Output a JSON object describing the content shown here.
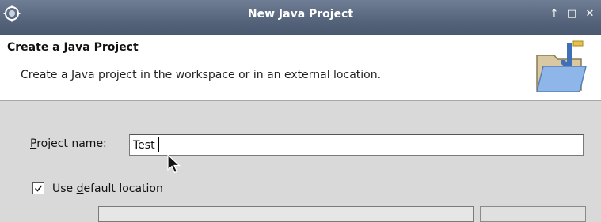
{
  "window": {
    "title": "New Java Project",
    "buttons": {
      "maximize": "↑",
      "restore": "□",
      "close": "✕"
    }
  },
  "header": {
    "title": "Create a Java Project",
    "description": "Create a Java project in the workspace or in an external location.",
    "image_icon": "java-project-folder-icon"
  },
  "form": {
    "project_name_label_mnemonic": "P",
    "project_name_label_rest": "roject name:",
    "project_name_value": "Test",
    "use_default_checked": true,
    "use_default_label_prefix": "Use ",
    "use_default_label_mnemonic": "d",
    "use_default_label_rest": "efault location"
  },
  "colors": {
    "titlebar": "#55647b",
    "dialog_bg": "#d9d9d9",
    "header_bg": "#ffffff"
  }
}
